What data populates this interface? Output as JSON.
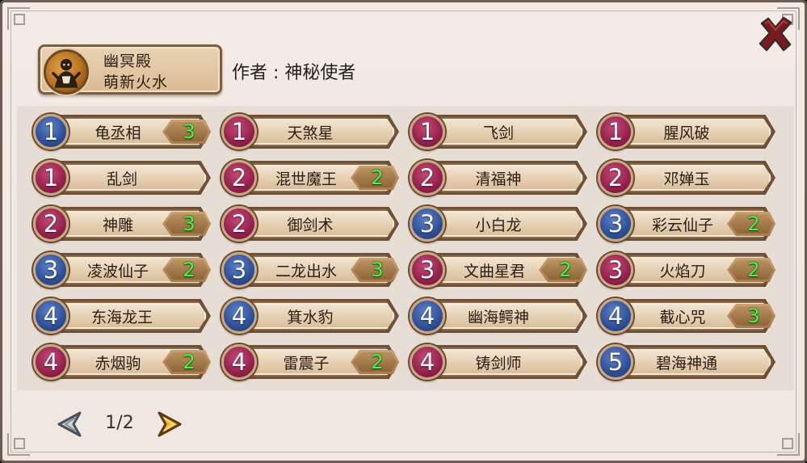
{
  "header": {
    "badge_line1": "幽冥殿",
    "badge_line2": "萌新火水",
    "author": "作者 : 神秘使者"
  },
  "colors": {
    "blue_token": "#2d4f98",
    "red_token": "#93214c",
    "count_text": "#4cf24a"
  },
  "cards": [
    {
      "num": "1",
      "color": "blue",
      "name": "龟丞相",
      "count": "3"
    },
    {
      "num": "1",
      "color": "red",
      "name": "天煞星",
      "count": ""
    },
    {
      "num": "1",
      "color": "red",
      "name": "飞剑",
      "count": ""
    },
    {
      "num": "1",
      "color": "red",
      "name": "腥风破",
      "count": ""
    },
    {
      "num": "1",
      "color": "red",
      "name": "乱剑",
      "count": ""
    },
    {
      "num": "2",
      "color": "red",
      "name": "混世魔王",
      "count": "2"
    },
    {
      "num": "2",
      "color": "red",
      "name": "清福神",
      "count": ""
    },
    {
      "num": "2",
      "color": "red",
      "name": "邓婵玉",
      "count": ""
    },
    {
      "num": "2",
      "color": "red",
      "name": "神雕",
      "count": "3"
    },
    {
      "num": "2",
      "color": "red",
      "name": "御剑术",
      "count": ""
    },
    {
      "num": "3",
      "color": "blue",
      "name": "小白龙",
      "count": ""
    },
    {
      "num": "3",
      "color": "blue",
      "name": "彩云仙子",
      "count": "2"
    },
    {
      "num": "3",
      "color": "blue",
      "name": "凌波仙子",
      "count": "2"
    },
    {
      "num": "3",
      "color": "blue",
      "name": "二龙出水",
      "count": "3"
    },
    {
      "num": "3",
      "color": "red",
      "name": "文曲星君",
      "count": "2"
    },
    {
      "num": "3",
      "color": "red",
      "name": "火焰刀",
      "count": "2"
    },
    {
      "num": "4",
      "color": "blue",
      "name": "东海龙王",
      "count": ""
    },
    {
      "num": "4",
      "color": "blue",
      "name": "箕水豹",
      "count": ""
    },
    {
      "num": "4",
      "color": "blue",
      "name": "幽海鳄神",
      "count": ""
    },
    {
      "num": "4",
      "color": "blue",
      "name": "截心咒",
      "count": "3"
    },
    {
      "num": "4",
      "color": "red",
      "name": "赤烟驹",
      "count": "2"
    },
    {
      "num": "4",
      "color": "red",
      "name": "雷震子",
      "count": "2"
    },
    {
      "num": "4",
      "color": "red",
      "name": "铸剑师",
      "count": ""
    },
    {
      "num": "5",
      "color": "blue",
      "name": "碧海神通",
      "count": ""
    }
  ],
  "pager": {
    "text": "1/2",
    "prev_icon": "arrow-left-icon",
    "next_icon": "arrow-right-icon"
  },
  "close_icon": "close-x-icon"
}
